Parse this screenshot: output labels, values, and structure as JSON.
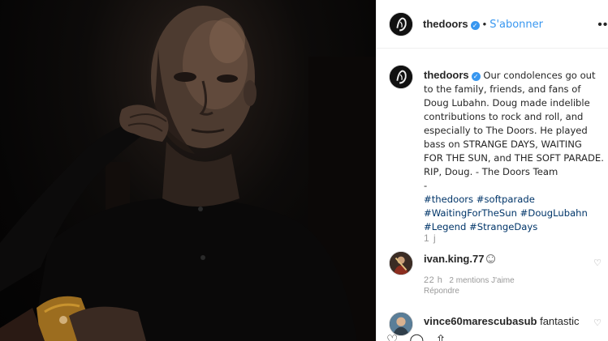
{
  "post": {
    "username": "thedoors",
    "follow_label": "S'abonner",
    "more_label": "•••"
  },
  "caption": {
    "username": "thedoors",
    "text": "Our condolences go out to the family, friends, and fans of Doug Lubahn. Doug made indelible contributions to rock and roll, and especially to The Doors. He played bass on STRANGE DAYS, WAITING FOR THE SUN, and THE SOFT PARADE. RIP, Doug. - The Doors Team",
    "dash": "-",
    "hashtags": [
      "#thedoors",
      "#softparade",
      "#WaitingForTheSun",
      "#DougLubahn",
      "#Legend",
      "#StrangeDays"
    ],
    "time": "1 j"
  },
  "comments": [
    {
      "username": "ivan.king.77",
      "text": "",
      "time": "22 h",
      "mentions": "2 mentions J'aime",
      "reply_label": "Répondre"
    },
    {
      "username": "vince60marescubasub",
      "text": "fantastic"
    }
  ],
  "icons": {
    "verified": "verified-badge",
    "comment_heart": "heart-outline",
    "actions": [
      "heart-outline",
      "comment-bubble",
      "share-arrow"
    ]
  },
  "colors": {
    "link": "#003569",
    "follow": "#3897f0",
    "muted": "#999999"
  }
}
